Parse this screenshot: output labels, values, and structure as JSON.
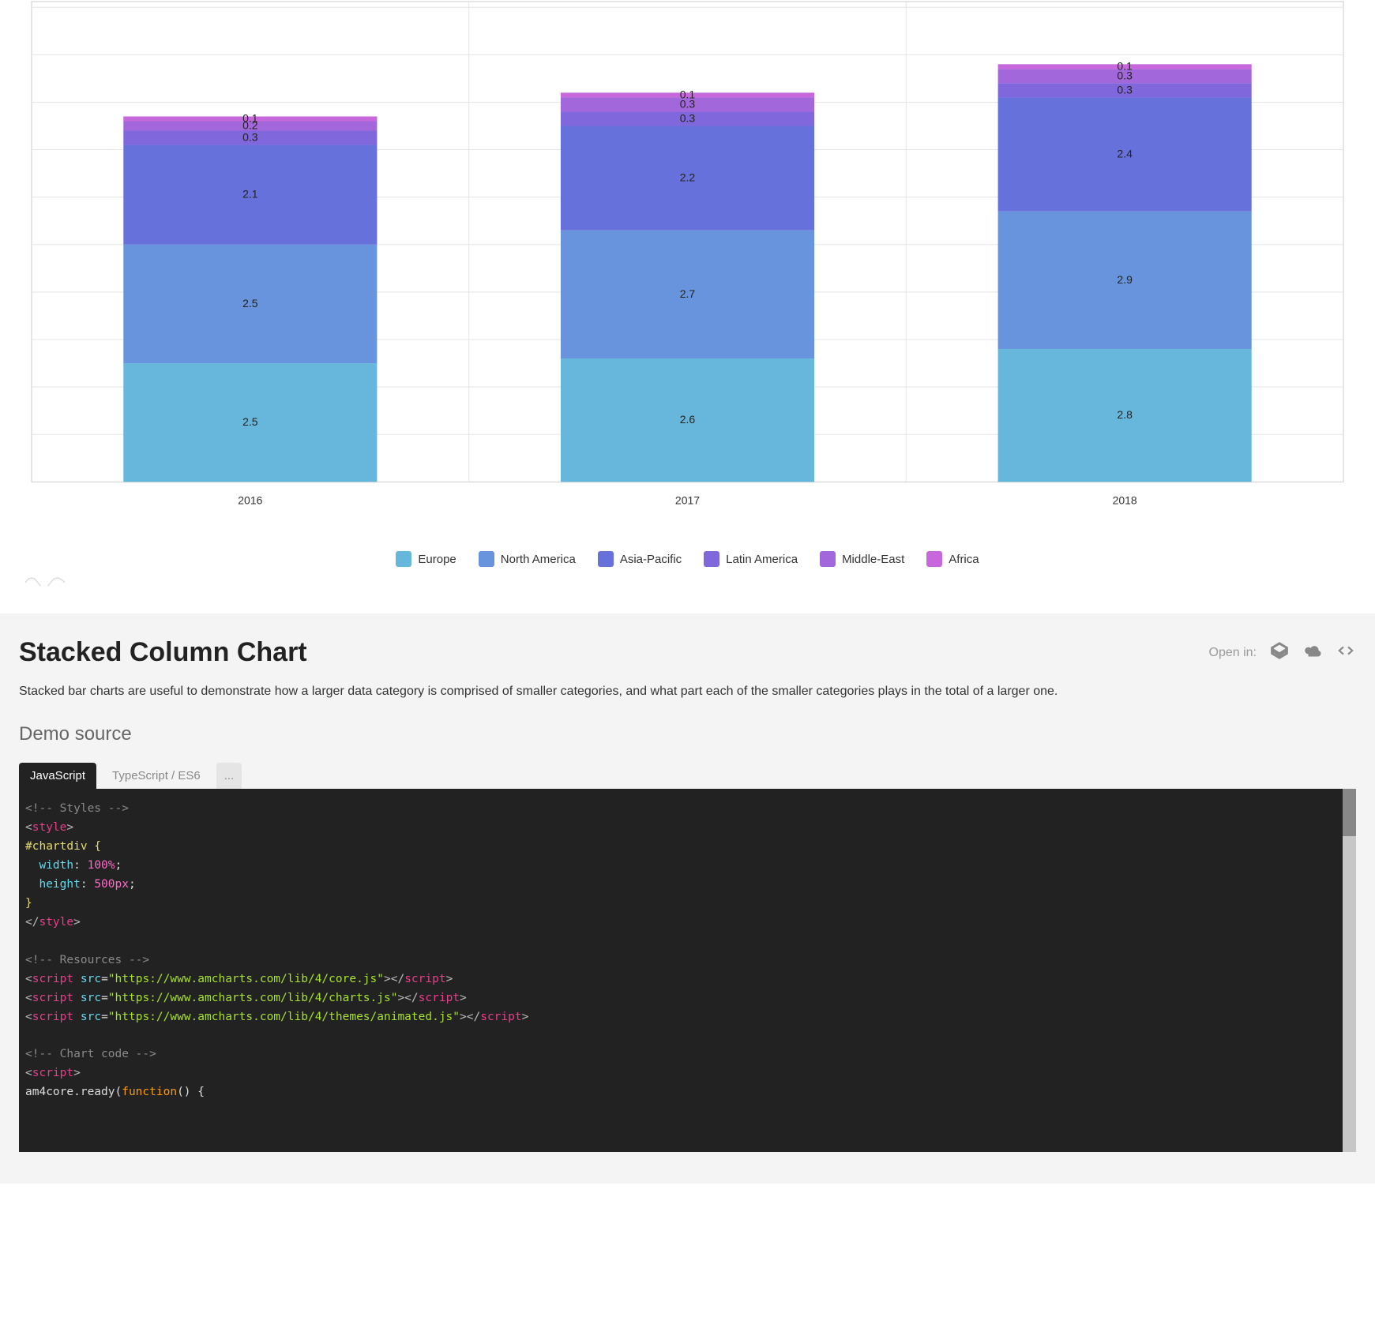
{
  "chart_data": {
    "type": "bar",
    "stacked": true,
    "categories": [
      "2016",
      "2017",
      "2018"
    ],
    "series": [
      {
        "name": "Europe",
        "color": "#67b7dc",
        "values": [
          2.5,
          2.6,
          2.8
        ]
      },
      {
        "name": "North America",
        "color": "#6794dc",
        "values": [
          2.5,
          2.7,
          2.9
        ]
      },
      {
        "name": "Asia-Pacific",
        "color": "#6771dc",
        "values": [
          2.1,
          2.2,
          2.4
        ]
      },
      {
        "name": "Latin America",
        "color": "#8067dc",
        "values": [
          0.3,
          0.3,
          0.3
        ]
      },
      {
        "name": "Middle-East",
        "color": "#a367dc",
        "values": [
          0.2,
          0.3,
          0.3
        ]
      },
      {
        "name": "Africa",
        "color": "#c767dc",
        "values": [
          0.1,
          0.1,
          0.1
        ]
      }
    ],
    "xlabel": "",
    "ylabel": "",
    "ylim": [
      0,
      10
    ],
    "grid": true,
    "legend_position": "bottom"
  },
  "page": {
    "title": "Stacked Column Chart",
    "open_in_label": "Open in:",
    "description": "Stacked bar charts are useful to demonstrate how a larger data category is comprised of smaller categories, and what part each of the smaller categories plays in the total of a larger one.",
    "demo_source_heading": "Demo source",
    "tabs": {
      "js": "JavaScript",
      "ts": "TypeScript / ES6",
      "more": "..."
    }
  },
  "code": {
    "line1": "<!-- Styles -->",
    "line5": "#chartdiv {",
    "line6_prop": "width",
    "line6_val": "100%",
    "line7_prop": "height",
    "line7_val": "500px",
    "line11": "<!-- Resources -->",
    "src_core": "\"https://www.amcharts.com/lib/4/core.js\"",
    "src_charts": "\"https://www.amcharts.com/lib/4/charts.js\"",
    "src_anim": "\"https://www.amcharts.com/lib/4/themes/animated.js\"",
    "line16": "<!-- Chart code -->",
    "line18a": "am4core.ready(",
    "line18b": "function",
    "line18c": "() {"
  }
}
